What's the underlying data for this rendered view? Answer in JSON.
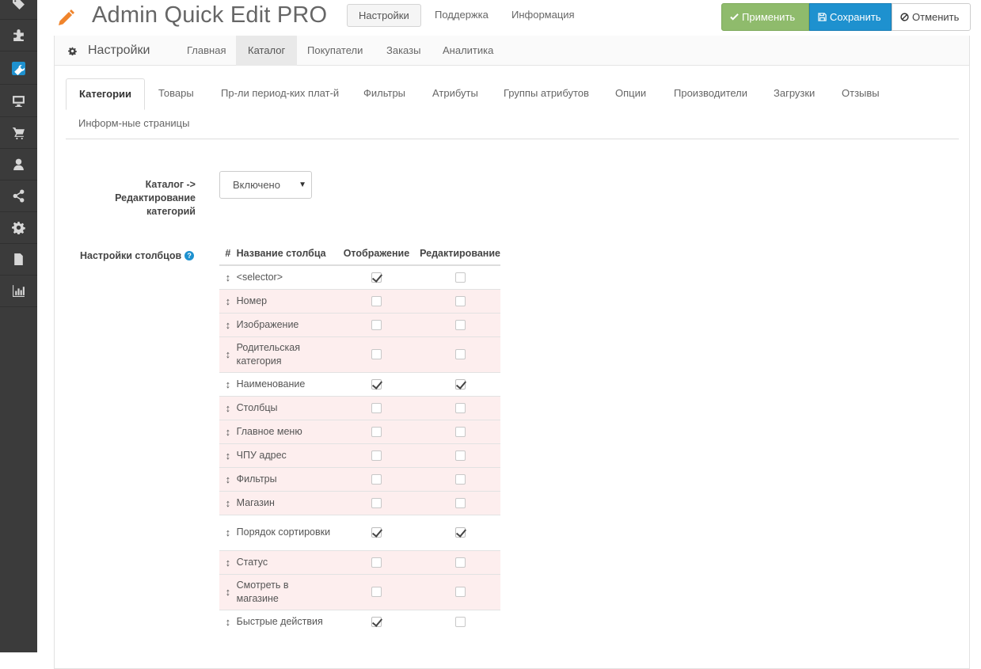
{
  "header": {
    "title": "Admin Quick Edit PRO",
    "tabs": [
      "Настройки",
      "Поддержка",
      "Информация"
    ],
    "buttons": {
      "apply": "Применить",
      "save": "Сохранить",
      "cancel": "Отменить"
    }
  },
  "sidebar": {
    "icons": [
      "tags-icon",
      "puzzle-icon",
      "wrench-icon",
      "desktop-icon",
      "cart-icon",
      "user-icon",
      "share-icon",
      "cog-icon",
      "file-icon",
      "chart-icon"
    ],
    "active": "wrench-icon"
  },
  "panel": {
    "title": "Настройки",
    "tabs": [
      "Главная",
      "Каталог",
      "Покупатели",
      "Заказы",
      "Аналитика"
    ],
    "active_tab": "Каталог"
  },
  "subtabs": {
    "items": [
      "Категории",
      "Товары",
      "Пр-ли период-ких плат-й",
      "Фильтры",
      "Атрибуты",
      "Группы атрибутов",
      "Опции",
      "Производители",
      "Загрузки",
      "Отзывы",
      "Информ-ные страницы"
    ],
    "active": "Категории"
  },
  "form": {
    "catalog_label": "Каталог -> Редактирование категорий",
    "catalog_status": "Включено",
    "columns_label": "Настройки столбцов",
    "help": "?"
  },
  "table": {
    "headers": {
      "num": "#",
      "name": "Название столбца",
      "show": "Отображение",
      "edit": "Редактирование"
    },
    "handle": "↕",
    "rows": [
      {
        "name": "<selector>",
        "show": true,
        "edit": false
      },
      {
        "name": "Номер",
        "show": false,
        "edit": false
      },
      {
        "name": "Изображение",
        "show": false,
        "edit": false
      },
      {
        "name": "Родительская категория",
        "show": false,
        "edit": false
      },
      {
        "name": "Наименование",
        "show": true,
        "edit": true
      },
      {
        "name": "Столбцы",
        "show": false,
        "edit": false
      },
      {
        "name": "Главное меню",
        "show": false,
        "edit": false
      },
      {
        "name": "ЧПУ адрес",
        "show": false,
        "edit": false
      },
      {
        "name": "Фильтры",
        "show": false,
        "edit": false
      },
      {
        "name": "Магазин",
        "show": false,
        "edit": false
      },
      {
        "name": "Порядок сортировки",
        "show": true,
        "edit": true
      },
      {
        "name": "Статус",
        "show": false,
        "edit": false
      },
      {
        "name": "Смотреть в магазине",
        "show": false,
        "edit": false
      },
      {
        "name": "Быстрые действия",
        "show": true,
        "edit": false
      }
    ]
  }
}
